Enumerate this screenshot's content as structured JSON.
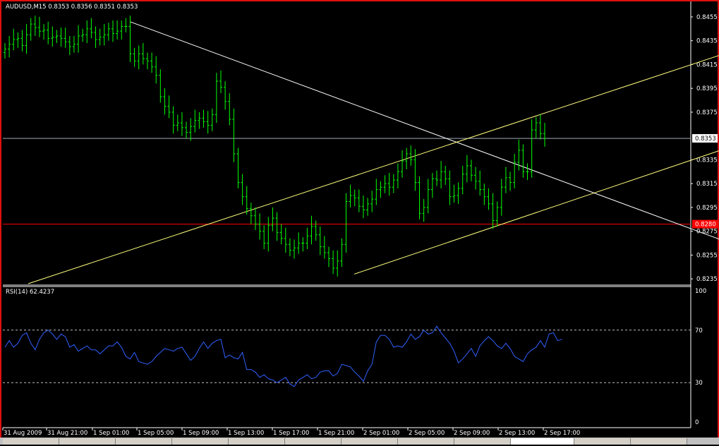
{
  "chart_header": {
    "title": "AUDUSD,M15",
    "ohlc": "0.8353 0.8356 0.8351 0.8353"
  },
  "price_axis": {
    "ticks": [
      "0.8455",
      "0.8435",
      "0.8415",
      "0.8395",
      "0.8375",
      "0.8353",
      "0.8335",
      "0.8315",
      "0.8295",
      "0.8275",
      "0.8255",
      "0.8235"
    ],
    "current_price_label": "0.8353",
    "marked_level_label": "0.8280"
  },
  "indicator": {
    "title": "RSI(14) 62.4237",
    "ticks": [
      "100",
      "70",
      "30",
      "0"
    ]
  },
  "time_axis": {
    "labels": [
      "31 Aug 2009",
      "31 Aug 21:00",
      "1 Sep 01:00",
      "1 Sep 05:00",
      "1 Sep 09:00",
      "1 Sep 13:00",
      "1 Sep 17:00",
      "1 Sep 21:00",
      "2 Sep 01:00",
      "2 Sep 05:00",
      "2 Sep 09:00",
      "2 Sep 13:00",
      "2 Sep 17:00"
    ]
  },
  "tabs": [
    "",
    "",
    "",
    "",
    "",
    "",
    "",
    "",
    "",
    "",
    "",
    ""
  ],
  "colors": {
    "bars": "#00ff00",
    "trendline_white": "#ffffff",
    "channel_yellow": "#ffff7f",
    "level_red": "#ff0000",
    "rsi_line": "#3060ff",
    "grid": "#808080"
  },
  "chart_data": [
    {
      "type": "line",
      "title": "AUDUSD,M15",
      "ylim": [
        0.8228,
        0.8468
      ],
      "x_labels": [
        "31 Aug 2009",
        "31 Aug 21:00",
        "1 Sep 01:00",
        "1 Sep 05:00",
        "1 Sep 09:00",
        "1 Sep 13:00",
        "1 Sep 17:00",
        "1 Sep 21:00",
        "2 Sep 01:00",
        "2 Sep 05:00",
        "2 Sep 09:00",
        "2 Sep 13:00",
        "2 Sep 17:00"
      ],
      "close": [
        0.8428,
        0.8432,
        0.8436,
        0.8437,
        0.8431,
        0.844,
        0.8449,
        0.8446,
        0.8443,
        0.8444,
        0.8437,
        0.8438,
        0.8439,
        0.8437,
        0.8434,
        0.843,
        0.8432,
        0.8439,
        0.844,
        0.8445,
        0.8442,
        0.8436,
        0.8438,
        0.844,
        0.8445,
        0.8441,
        0.8443,
        0.8447,
        0.8447,
        0.8424,
        0.8418,
        0.8424,
        0.842,
        0.8418,
        0.8413,
        0.8406,
        0.8388,
        0.838,
        0.8375,
        0.8364,
        0.8366,
        0.8362,
        0.8358,
        0.8363,
        0.8368,
        0.837,
        0.8367,
        0.8364,
        0.8373,
        0.8401,
        0.8396,
        0.8384,
        0.8369,
        0.834,
        0.8316,
        0.8304,
        0.8294,
        0.8288,
        0.8281,
        0.8275,
        0.8265,
        0.828,
        0.8286,
        0.8274,
        0.8269,
        0.8264,
        0.8259,
        0.8261,
        0.8265,
        0.8265,
        0.8271,
        0.8279,
        0.8272,
        0.8262,
        0.8257,
        0.8252,
        0.8244,
        0.825,
        0.8264,
        0.83,
        0.8305,
        0.8303,
        0.8296,
        0.8293,
        0.8298,
        0.8302,
        0.831,
        0.8312,
        0.8315,
        0.8312,
        0.8318,
        0.8325,
        0.8334,
        0.834,
        0.8335,
        0.8316,
        0.829,
        0.8295,
        0.831,
        0.8319,
        0.8318,
        0.8325,
        0.8319,
        0.8304,
        0.8305,
        0.8311,
        0.8323,
        0.833,
        0.8322,
        0.8317,
        0.831,
        0.8304,
        0.8298,
        0.8284,
        0.8295,
        0.8312,
        0.832,
        0.8316,
        0.8333,
        0.8343,
        0.8325,
        0.8325,
        0.836,
        0.8366,
        0.8357,
        0.8353
      ]
    },
    {
      "type": "line",
      "title": "RSI(14) 62.4237",
      "ylim": [
        0,
        100
      ],
      "levels": [
        70,
        30
      ],
      "series": [
        {
          "values": [
            57,
            62,
            57,
            60,
            66,
            68,
            60,
            55,
            63,
            68,
            70,
            67,
            63,
            67,
            65,
            57,
            59,
            54,
            56,
            58,
            55,
            55,
            52,
            55,
            58,
            58,
            61,
            57,
            50,
            48,
            53,
            46,
            45,
            44,
            46,
            50,
            53,
            56,
            55,
            54,
            56,
            57,
            52,
            47,
            50,
            56,
            61,
            56,
            60,
            62,
            63,
            49,
            51,
            49,
            48,
            53,
            40,
            40,
            38,
            34,
            36,
            33,
            32,
            30,
            32,
            34,
            29,
            27,
            32,
            34,
            36,
            33,
            34,
            38,
            39,
            39,
            35,
            37,
            44,
            43,
            42,
            38,
            35,
            31,
            39,
            44,
            61,
            66,
            66,
            63,
            57,
            58,
            57,
            61,
            67,
            63,
            65,
            70,
            67,
            68,
            73,
            68,
            64,
            60,
            54,
            45,
            48,
            52,
            56,
            50,
            58,
            62,
            65,
            62,
            58,
            56,
            60,
            56,
            50,
            48,
            46,
            52,
            55,
            57,
            62,
            57,
            67,
            68,
            62,
            63
          ]
        }
      ]
    }
  ]
}
